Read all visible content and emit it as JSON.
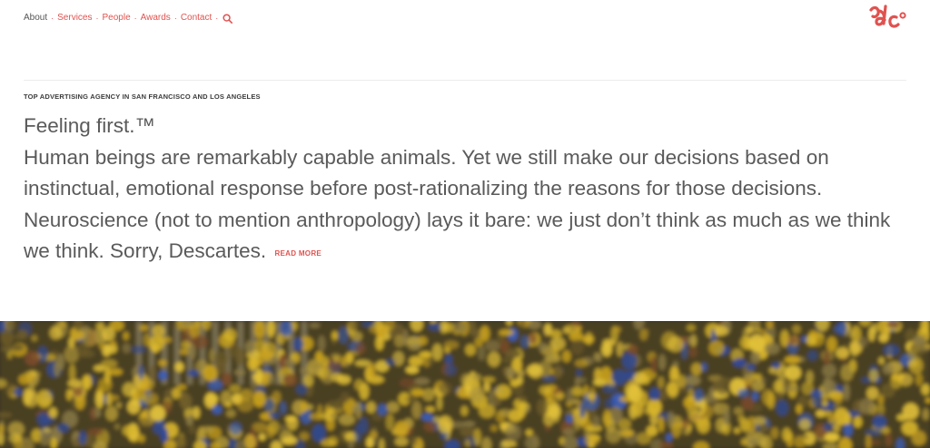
{
  "nav": {
    "items": [
      {
        "label": "About",
        "active": true
      },
      {
        "label": "Services",
        "active": false
      },
      {
        "label": "People",
        "active": false
      },
      {
        "label": "Awards",
        "active": false
      },
      {
        "label": "Contact",
        "active": false
      }
    ],
    "separator": "·",
    "search_icon": "magnifier-icon"
  },
  "logo": {
    "icon": "dc-logo-icon"
  },
  "intro": {
    "eyebrow": "TOP ADVERTISING AGENCY IN SAN FRANCISCO AND LOS ANGELES",
    "headline": "Feeling first.™",
    "body": "Human beings are remarkably capable animals. Yet we still make our decisions based on instinctual, emotional response before post-rationalizing the reasons for those decisions. Neuroscience (not to mention anthropology) lays it bare: we just don’t think as much as we think we think. Sorry, Descartes.",
    "read_more": "READ MORE"
  },
  "hero": {
    "image": "stadium crowd in yellow and blue"
  },
  "colors": {
    "accent": "#e0524f",
    "text_body": "#5a5a5a",
    "text_dark": "#3b3b3b",
    "nav_active": "#555555",
    "divider": "#ececec"
  }
}
